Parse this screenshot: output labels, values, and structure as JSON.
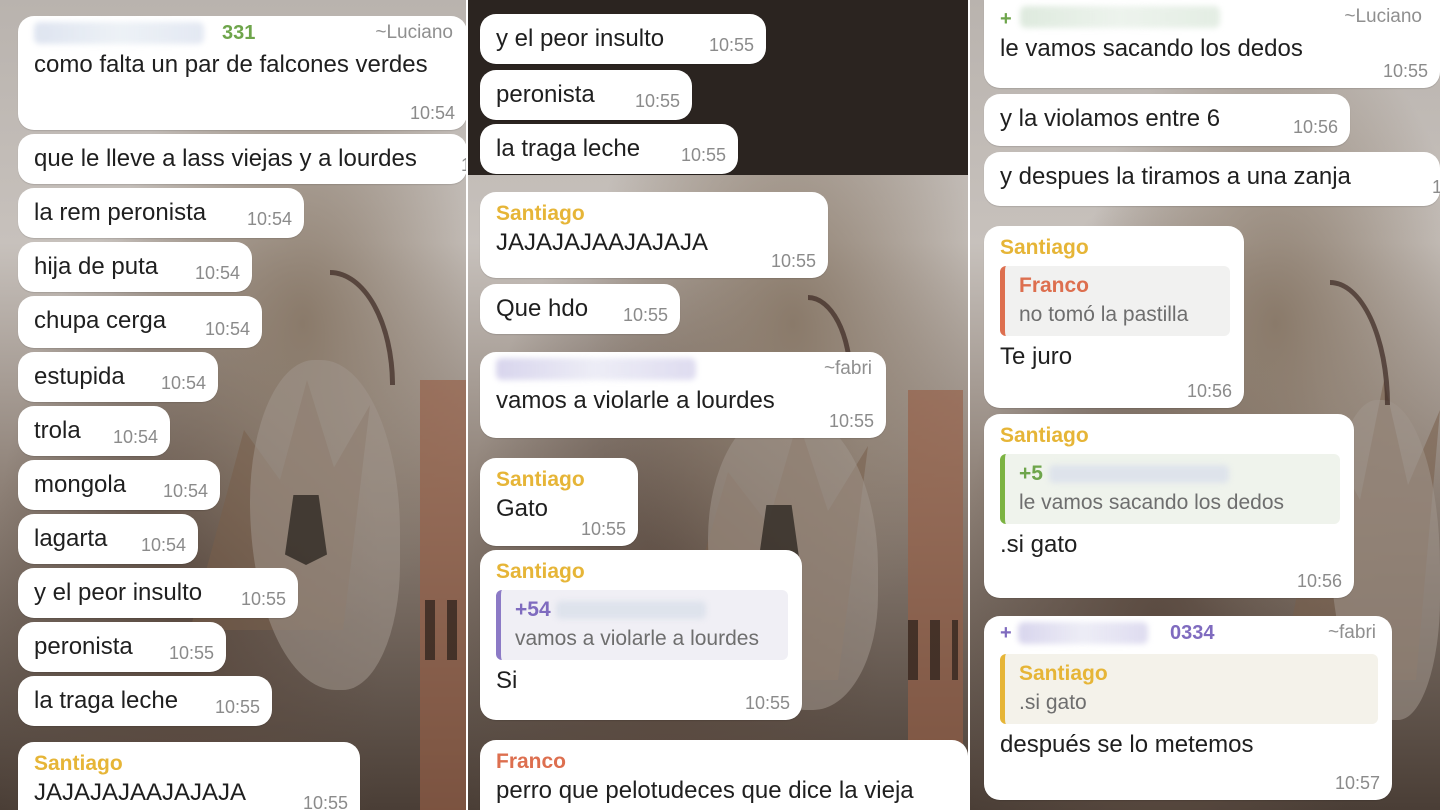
{
  "panel1": {
    "header_number_fragment": "331",
    "header_alias": "~Luciano",
    "messages": [
      {
        "text": "como falta un par de falcones verdes",
        "time": "10:54"
      },
      {
        "text": "que le lleve a lass viejas y a lourdes",
        "time": "1"
      },
      {
        "text": "la rem peronista",
        "time": "10:54"
      },
      {
        "text": "hija de puta",
        "time": "10:54"
      },
      {
        "text": "chupa cerga",
        "time": "10:54"
      },
      {
        "text": "estupida",
        "time": "10:54"
      },
      {
        "text": "trola",
        "time": "10:54"
      },
      {
        "text": "mongola",
        "time": "10:54"
      },
      {
        "text": "lagarta",
        "time": "10:54"
      },
      {
        "text": "y el peor insulto",
        "time": "10:55"
      },
      {
        "text": "peronista",
        "time": "10:55"
      },
      {
        "text": "la traga leche",
        "time": "10:55"
      }
    ],
    "last": {
      "sender": "Santiago",
      "text": "JAJAJAJAAJAJAJA",
      "time": "10:55"
    }
  },
  "panel2": {
    "messages": [
      {
        "text": "y el peor insulto",
        "time": "10:55"
      },
      {
        "text": "peronista",
        "time": "10:55"
      },
      {
        "text": "la traga leche",
        "time": "10:55"
      }
    ],
    "santiago_laugh": {
      "sender": "Santiago",
      "text": "JAJAJAJAAJAJAJA",
      "time": "10:55"
    },
    "que_hdo": {
      "text": "Que hdo",
      "time": "10:55"
    },
    "fabri_msg": {
      "alias": "~fabri",
      "text": "vamos a violarle a lourdes",
      "time": "10:55"
    },
    "gato": {
      "sender": "Santiago",
      "text": "Gato",
      "time": "10:55"
    },
    "si_reply": {
      "sender": "Santiago",
      "quote_number": "+54",
      "quote_text": "vamos a violarle a lourdes",
      "text": "Si",
      "time": "10:55"
    },
    "franco_last": {
      "sender": "Franco",
      "text": "perro que pelotudeces que dice la vieja"
    }
  },
  "panel3": {
    "header_alias": "~Luciano",
    "header_number_fragment": "+",
    "messages": [
      {
        "text": "le vamos sacando los dedos",
        "time": "10:55"
      },
      {
        "text": "y la violamos entre 6",
        "time": "10:56"
      },
      {
        "text": "y despues la tiramos a una zanja",
        "time": "1"
      }
    ],
    "te_juro": {
      "sender": "Santiago",
      "quote_name": "Franco",
      "quote_text": "no tomó la pastilla",
      "text": "Te juro",
      "time": "10:56"
    },
    "si_gato": {
      "sender": "Santiago",
      "quote_number": "+5",
      "quote_text": "le vamos sacando los dedos",
      "text": ".si gato",
      "time": "10:56"
    },
    "fabri_last": {
      "alias": "~fabri",
      "number_fragment_start": "+",
      "number_fragment_end": "0334",
      "quote_name": "Santiago",
      "quote_text": ".si gato",
      "text": "después se lo metemos",
      "time": "10:57"
    }
  },
  "colors": {
    "santiago": "#e6b537",
    "franco": "#dd6f4f",
    "green_contact": "#6ea54b",
    "purple_contact": "#7f6bbf",
    "bubble": "#ffffff",
    "timestamp": "#8b8b8b"
  }
}
